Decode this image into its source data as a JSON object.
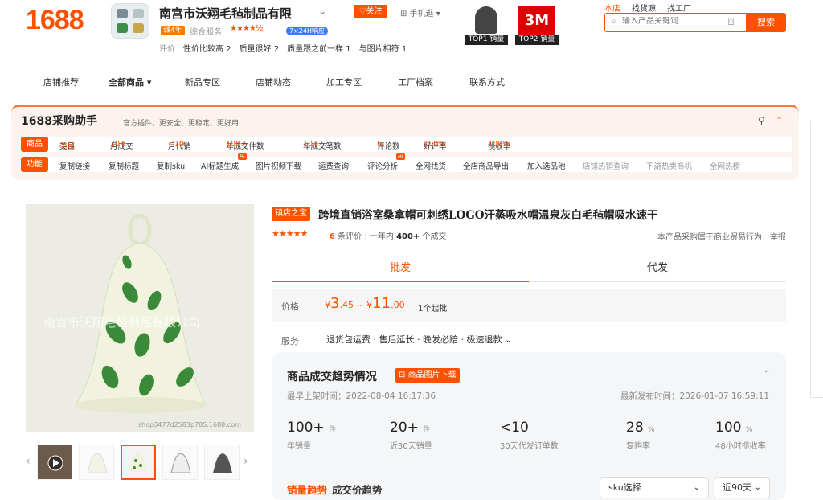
{
  "header": {
    "logo": "1688",
    "shop_name": "南宫市沃翔毛毡制品有限",
    "follow_label": "♡关注",
    "mobile_label": "⊞ 手机逛 ▾",
    "year_badge": "诚4年",
    "service_label": "综合服务",
    "service_stars": "★★★★½",
    "online_badge": "7×24H响应",
    "ratings_label": "评价",
    "ratings": [
      "性价比较高 2",
      "质量很好 2",
      "质量跟之前一样 1",
      "与图片相符 1"
    ],
    "top_badges": [
      "TOP1 销量",
      "TOP2 销量"
    ],
    "top2_brand": "3M"
  },
  "search": {
    "tabs": [
      "本店",
      "找货源",
      "找工厂"
    ],
    "placeholder": "输入产品关键词",
    "button": "搜索"
  },
  "nav": {
    "items": [
      "店铺推荐",
      "全部商品 ▾",
      "新品专区",
      "店铺动态",
      "加工专区",
      "工厂档案",
      "联系方式"
    ]
  },
  "assistant": {
    "title": "1688采购助手",
    "subtitle": "官方插件，更安全、更稳定、更好用",
    "product_tag": "商品",
    "product_row": [
      {
        "k": "类目",
        "v": "毛毡"
      },
      {
        "k": "月成交",
        "v": "20+"
      },
      {
        "k": "月代销",
        "v": "<10"
      },
      {
        "k": "年成交件数",
        "v": "100+"
      },
      {
        "k": "年成交笔数",
        "v": "10+"
      },
      {
        "k": "评论数",
        "v": "6"
      },
      {
        "k": "好评率",
        "v": "100%"
      },
      {
        "k": "揽收率",
        "v": "100%"
      }
    ],
    "func_tag": "功能",
    "func_row": [
      "复制链接",
      "复制标题",
      "复制sku",
      "AI标题生成",
      "图片视频下载",
      "运费查询",
      "评论分析",
      "全网找货",
      "全店商品导出",
      "加入选品池",
      "店铺热销查询",
      "下游热卖商机",
      "全网热榜"
    ],
    "ai_label": "AI"
  },
  "gallery": {
    "watermark": "南宫市沃翔毛毡制品有限公司",
    "caption": "shop3477d2583p785.1688.com"
  },
  "product": {
    "badge": "镇店之宝",
    "title": "跨境直销浴室桑拿帽可刺绣LOGO汗蒸吸水帽温泉灰白毛毡帽吸水速干",
    "stars": "★★★★★",
    "review_count": "6",
    "review_suffix": "条评价",
    "sales_prefix": "一年内",
    "sales_value": "400+",
    "sales_suffix": "个成交",
    "trade_note": "本产品采购属于商业贸易行为",
    "report": "举报",
    "tab_wholesale": "批发",
    "tab_dropship": "代发",
    "price_label": "价格",
    "price_low_int": "3",
    "price_low_dec": ".45",
    "price_high_int": "11",
    "price_high_dec": ".00",
    "currency": "¥",
    "moq": "1个起批",
    "service_label": "服务",
    "service_text": "退货包运费 · 售后延长 · 晚发必赔 · 极速退款 ⌄"
  },
  "trend": {
    "title": "商品成交趋势情况",
    "download": "⊡ 商品图片下载",
    "first_listed": "最早上架时间：2022-08-04 16:17:36",
    "latest": "最新发布时间：2026-01-07 16:59:11",
    "stats": [
      {
        "v": "100+",
        "u": "件",
        "l": "年销量"
      },
      {
        "v": "20+",
        "u": "件",
        "l": "近30天销量"
      },
      {
        "v": "<10",
        "u": "",
        "l": "30天代发订单数"
      },
      {
        "v": "28",
        "u": "%",
        "l": "复购率"
      },
      {
        "v": "100",
        "u": "%",
        "l": "48小时揽收率"
      }
    ],
    "tab_sales": "销量趋势",
    "tab_price": "成交价趋势",
    "sku_select": "sku选择",
    "days_select": "近90天"
  }
}
